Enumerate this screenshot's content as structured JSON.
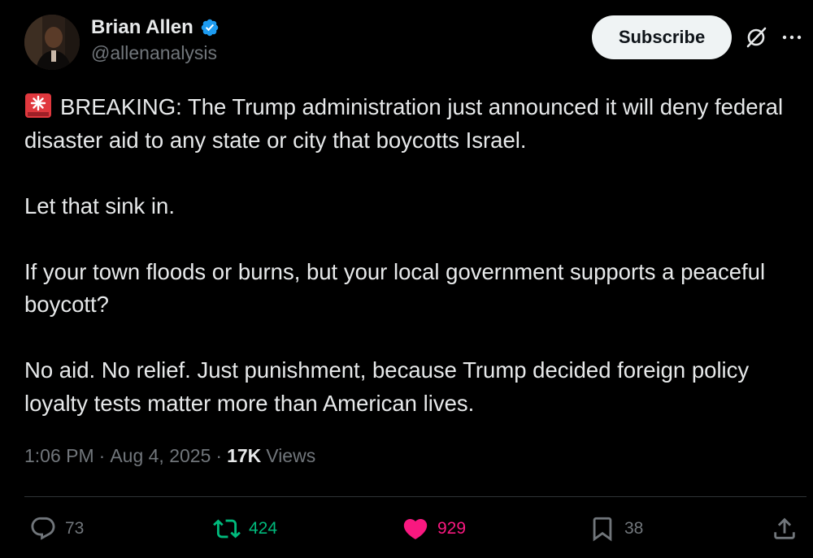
{
  "author": {
    "display_name": "Brian Allen",
    "handle": "@allenanalysis",
    "verified": true,
    "verified_color": "#1d9bf0"
  },
  "header": {
    "subscribe_label": "Subscribe",
    "grok_icon": "grok-icon",
    "more_icon": "more-icon"
  },
  "tweet": {
    "emoji": "rotating-light-icon",
    "paragraphs": [
      "BREAKING: The Trump administration just announced it will deny federal disaster aid to any state or city that boycotts Israel.",
      "Let that sink in.",
      "If your town floods or burns, but your local government supports a peaceful boycott?",
      "No aid. No relief. Just punishment, because Trump decided foreign policy loyalty tests matter more than American lives."
    ]
  },
  "meta": {
    "time": "1:06 PM",
    "separator": "·",
    "date": "Aug 4, 2025",
    "views_count": "17K",
    "views_label": "Views"
  },
  "actions": {
    "replies": "73",
    "reposts": "424",
    "likes": "929",
    "bookmarks": "38"
  },
  "colors": {
    "background": "#000000",
    "text": "#e7e9ea",
    "muted": "#71767b",
    "repost": "#00ba7c",
    "like": "#f91880",
    "divider": "#2f3336"
  }
}
